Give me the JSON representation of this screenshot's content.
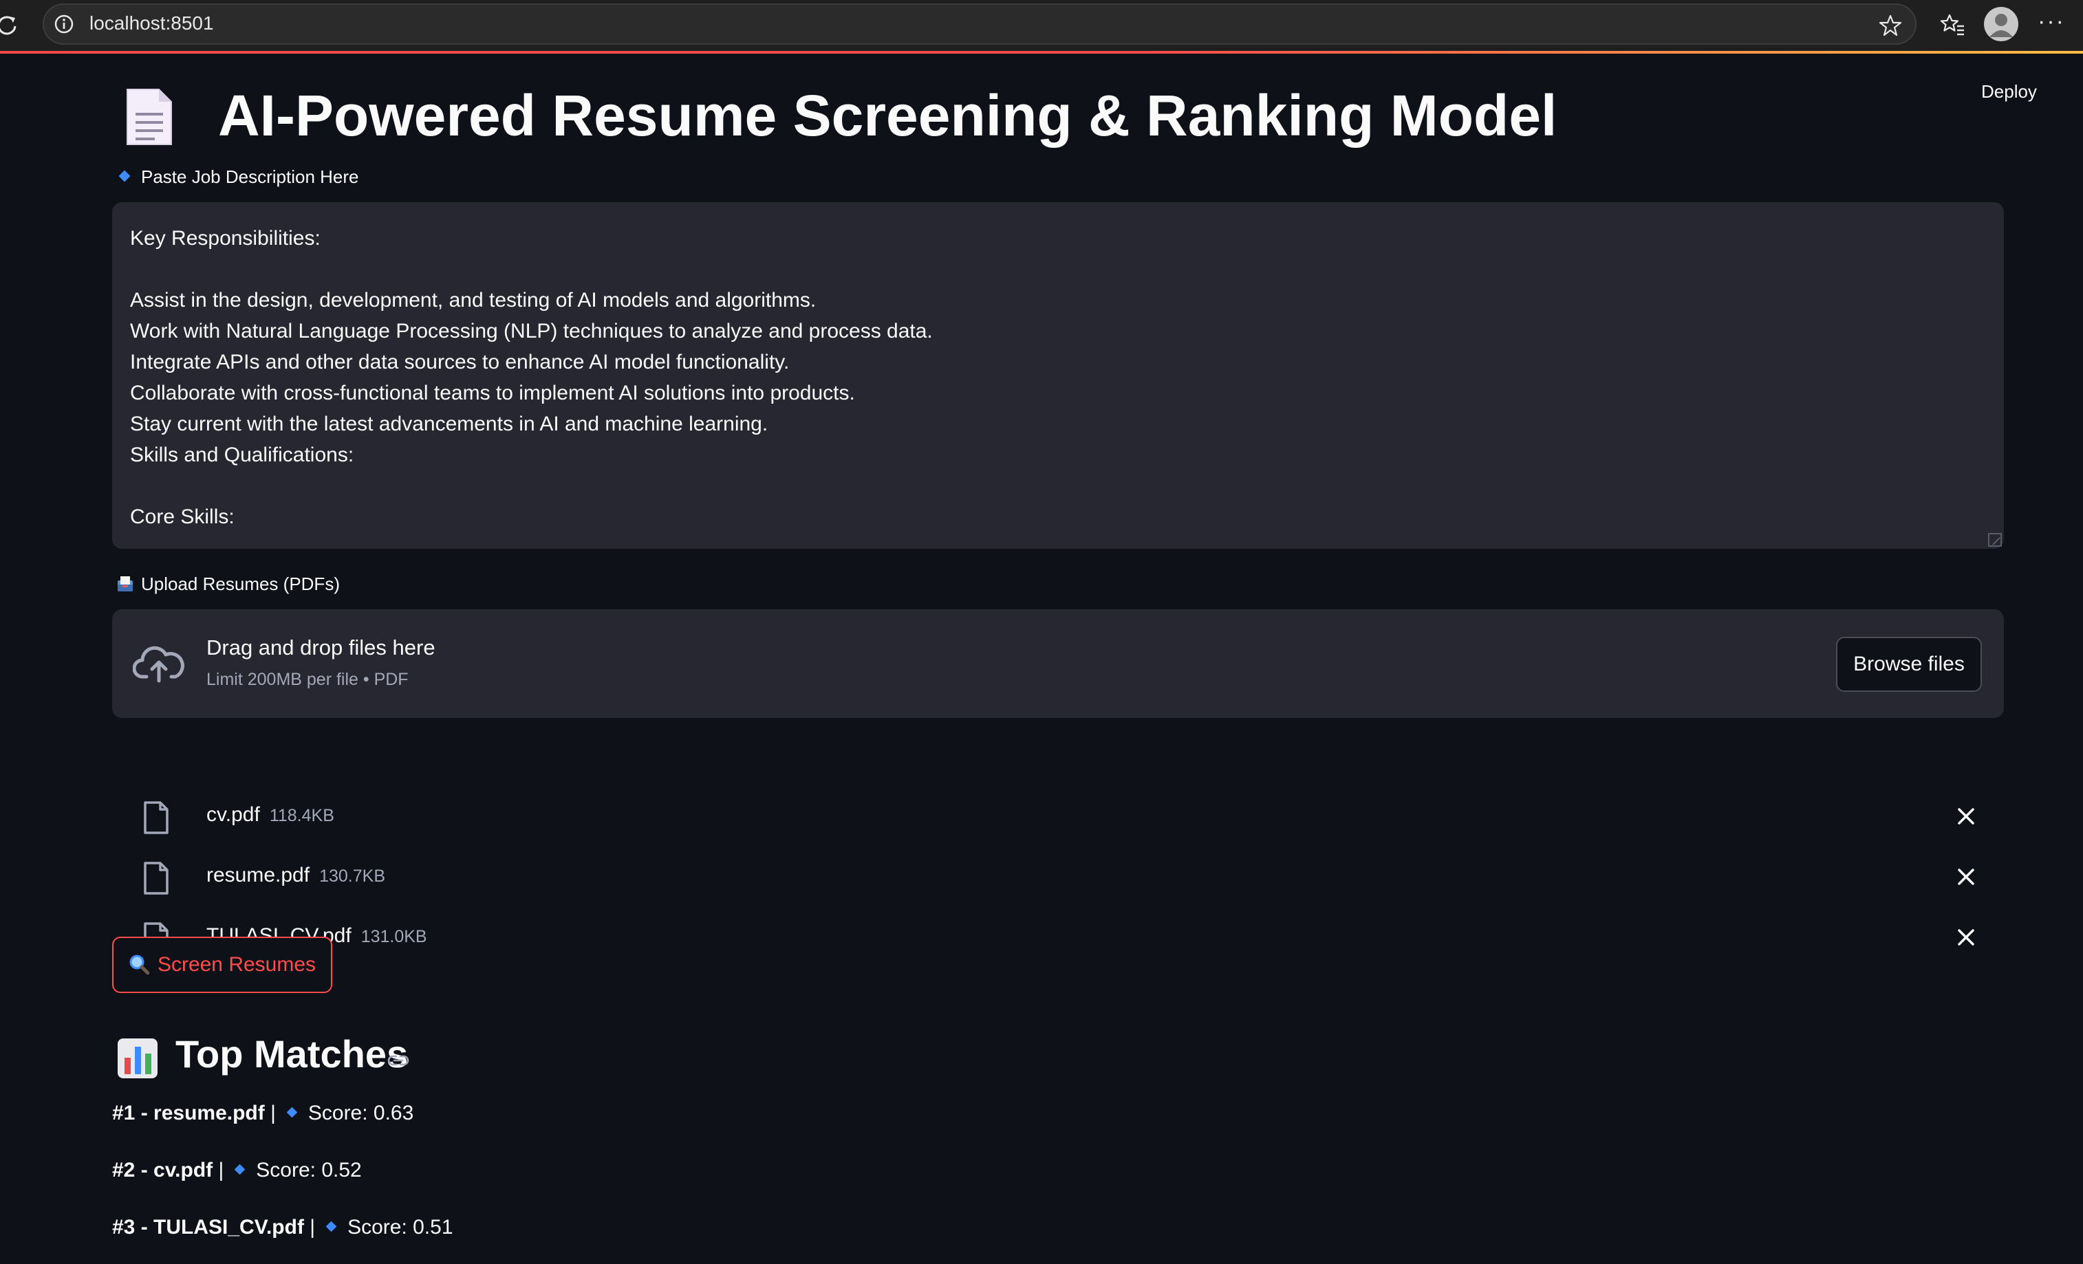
{
  "browser": {
    "url": "localhost:8501"
  },
  "app": {
    "deploy_label": "Deploy",
    "title": "AI-Powered Resume Screening & Ranking Model",
    "jd_label": "Paste Job Description Here",
    "jd_lines": [
      "Key Responsibilities:",
      "",
      "Assist in the design, development, and testing of AI models and algorithms.",
      "Work with Natural Language Processing (NLP) techniques to analyze and process data.",
      "Integrate APIs and other data sources to enhance AI model functionality.",
      "Collaborate with cross-functional teams to implement AI solutions into products.",
      "Stay current with the latest advancements in AI and machine learning.",
      "Skills and Qualifications:",
      "",
      "Core Skills:"
    ],
    "upload_label": "Upload Resumes (PDFs)",
    "uploader": {
      "drag_text": "Drag and drop files here",
      "limit_text": "Limit 200MB per file • PDF",
      "browse_label": "Browse files"
    },
    "files": [
      {
        "name": "cv.pdf",
        "size": "118.4KB"
      },
      {
        "name": "resume.pdf",
        "size": "130.7KB"
      },
      {
        "name": "TULASI_CV.pdf",
        "size": "131.0KB"
      }
    ],
    "screen_button_label": "Screen Resumes",
    "matches_heading": "Top Matches",
    "results": [
      {
        "rank_text": "#1 - resume.pdf",
        "score_text": "Score: 0.63"
      },
      {
        "rank_text": "#2 - cv.pdf",
        "score_text": "Score: 0.52"
      },
      {
        "rank_text": "#3 - TULASI_CV.pdf",
        "score_text": "Score: 0.51"
      }
    ]
  },
  "icons": {
    "reload": "reload-icon",
    "info": "info-icon",
    "star": "star-icon",
    "favorites": "favorites-icon",
    "avatar": "profile-avatar",
    "more": "more-icon",
    "title": "document-icon",
    "diamond": "blue-diamond-icon",
    "inbox": "inbox-tray-icon",
    "cloud": "cloud-upload-icon",
    "file": "file-icon",
    "close": "close-icon",
    "search": "magnifier-icon",
    "chart": "bar-chart-icon",
    "link": "link-icon"
  },
  "colors": {
    "background": "#0e1117",
    "panel": "#262730",
    "accent": "#ff4b4b",
    "diamond": "#3d8bfd",
    "muted_text": "#a3a8b8"
  }
}
